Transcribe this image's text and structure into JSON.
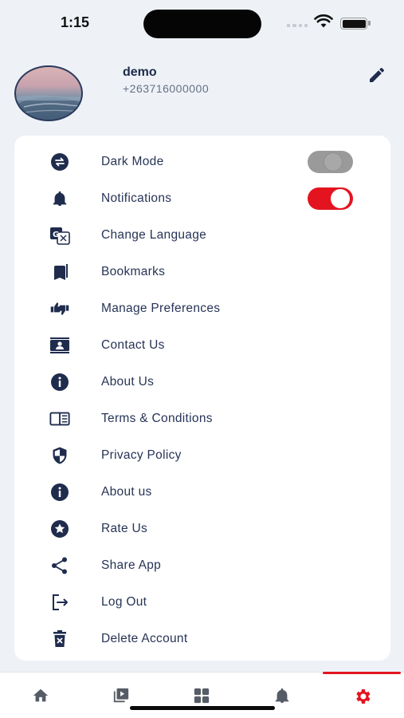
{
  "status_bar": {
    "time": "1:15"
  },
  "profile": {
    "name": "demo",
    "phone": "+263716000000",
    "edit_icon": "pencil-icon"
  },
  "settings": {
    "items": [
      {
        "label": "Dark Mode",
        "icon": "swap-icon",
        "toggle": "off"
      },
      {
        "label": "Notifications",
        "icon": "bell-icon",
        "toggle": "on"
      },
      {
        "label": "Change Language",
        "icon": "translate-icon"
      },
      {
        "label": "Bookmarks",
        "icon": "bookmarks-icon"
      },
      {
        "label": "Manage Preferences",
        "icon": "thumbs-up-down-icon"
      },
      {
        "label": "Contact Us",
        "icon": "contact-card-icon"
      },
      {
        "label": "About Us",
        "icon": "info-icon"
      },
      {
        "label": "Terms & Conditions",
        "icon": "book-icon"
      },
      {
        "label": "Privacy Policy",
        "icon": "shield-icon"
      },
      {
        "label": "About us",
        "icon": "info-icon"
      },
      {
        "label": "Rate Us",
        "icon": "star-icon"
      },
      {
        "label": "Share App",
        "icon": "share-icon"
      },
      {
        "label": "Log Out",
        "icon": "logout-icon"
      },
      {
        "label": "Delete Account",
        "icon": "trash-icon"
      }
    ]
  },
  "bottom_nav": {
    "items": [
      {
        "icon": "home-icon",
        "active": false
      },
      {
        "icon": "video-library-icon",
        "active": false
      },
      {
        "icon": "grid-icon",
        "active": false
      },
      {
        "icon": "bell-icon",
        "active": false
      },
      {
        "icon": "gear-icon",
        "active": true
      }
    ]
  },
  "colors": {
    "accent": "#e3141f",
    "text": "#273456",
    "background": "#eef2f7"
  }
}
